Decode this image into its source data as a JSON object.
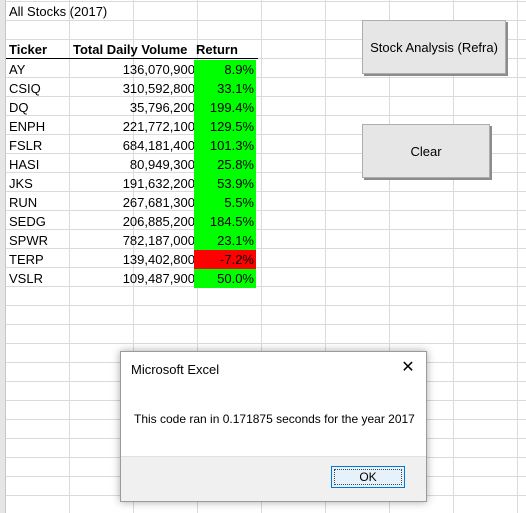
{
  "sheet": {
    "title": "All Stocks (2017)",
    "headers": {
      "ticker": "Ticker",
      "volume": "Total Daily Volume",
      "return": "Return"
    },
    "rows": [
      {
        "ticker": "AY",
        "volume": "136,070,900",
        "return": "8.9%",
        "status": "positive"
      },
      {
        "ticker": "CSIQ",
        "volume": "310,592,800",
        "return": "33.1%",
        "status": "positive"
      },
      {
        "ticker": "DQ",
        "volume": "35,796,200",
        "return": "199.4%",
        "status": "positive"
      },
      {
        "ticker": "ENPH",
        "volume": "221,772,100",
        "return": "129.5%",
        "status": "positive"
      },
      {
        "ticker": "FSLR",
        "volume": "684,181,400",
        "return": "101.3%",
        "status": "positive"
      },
      {
        "ticker": "HASI",
        "volume": "80,949,300",
        "return": "25.8%",
        "status": "positive"
      },
      {
        "ticker": "JKS",
        "volume": "191,632,200",
        "return": "53.9%",
        "status": "positive"
      },
      {
        "ticker": "RUN",
        "volume": "267,681,300",
        "return": "5.5%",
        "status": "positive"
      },
      {
        "ticker": "SEDG",
        "volume": "206,885,200",
        "return": "184.5%",
        "status": "positive"
      },
      {
        "ticker": "SPWR",
        "volume": "782,187,000",
        "return": "23.1%",
        "status": "positive"
      },
      {
        "ticker": "TERP",
        "volume": "139,402,800",
        "return": "-7.2%",
        "status": "negative"
      },
      {
        "ticker": "VSLR",
        "volume": "109,487,900",
        "return": "50.0%",
        "status": "positive"
      }
    ]
  },
  "colors": {
    "positive": "#00ff00",
    "negative": "#ff0000"
  },
  "buttons": {
    "analysis_label": "Stock Analysis (Refra)",
    "clear_label": "Clear"
  },
  "dialog": {
    "title": "Microsoft Excel",
    "message": "This code ran in 0.171875 seconds for the year 2017",
    "ok_label": "OK",
    "close_icon": "close-icon"
  }
}
